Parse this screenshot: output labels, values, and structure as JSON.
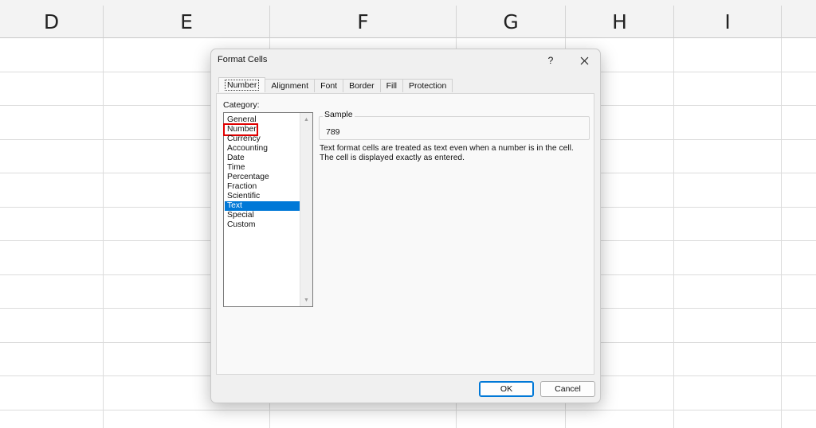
{
  "sheet": {
    "columns": [
      "D",
      "E",
      "F",
      "G",
      "H",
      "I"
    ]
  },
  "dialog": {
    "title": "Format Cells",
    "help_label": "?",
    "tabs": [
      {
        "label": "Number"
      },
      {
        "label": "Alignment"
      },
      {
        "label": "Font"
      },
      {
        "label": "Border"
      },
      {
        "label": "Fill"
      },
      {
        "label": "Protection"
      }
    ],
    "category_label": "Category:",
    "categories": [
      "General",
      "Number",
      "Currency",
      "Accounting",
      "Date",
      "Time",
      "Percentage",
      "Fraction",
      "Scientific",
      "Text",
      "Special",
      "Custom"
    ],
    "selected_category": "Text",
    "highlighted_category": "Number",
    "sample_label": "Sample",
    "sample_value": "789",
    "description_line1": "Text format cells are treated as text even when a number is in the cell.",
    "description_line2": "The cell is displayed exactly as entered.",
    "ok_label": "OK",
    "cancel_label": "Cancel",
    "accent_color": "#0078d7",
    "highlight_color": "#e00000"
  }
}
